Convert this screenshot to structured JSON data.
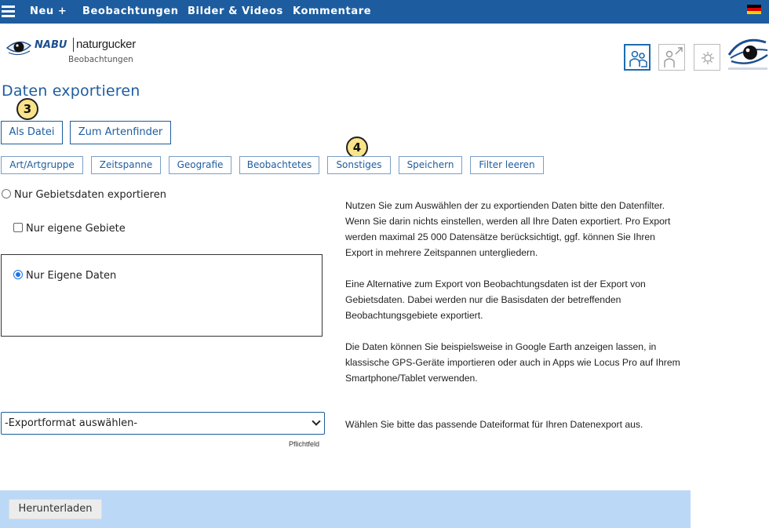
{
  "nav": {
    "items": [
      "Neu +",
      "Beobachtungen",
      "Bilder & Videos",
      "Kommentare"
    ],
    "flag_icon": "german-flag-icon"
  },
  "header": {
    "logo_nabu": "NABU",
    "logo_naturgucker": "naturgucker",
    "logo_subtitle": "Beobachtungen",
    "icons": [
      "community-icon",
      "user-share-icon",
      "settings-icon"
    ]
  },
  "page": {
    "title": "Daten exportieren"
  },
  "markers": [
    "3",
    "4"
  ],
  "mode_buttons": [
    "Als Datei",
    "Zum Artenfinder"
  ],
  "filter_buttons": [
    "Art/Artgruppe",
    "Zeitspanne",
    "Geografie",
    "Beobachtetes",
    "Sonstiges",
    "Speichern",
    "Filter leeren"
  ],
  "options": {
    "area_data_label": "Nur Gebietsdaten exportieren",
    "own_areas_label": "Nur eigene Gebiete",
    "own_data_label": "Nur Eigene Daten"
  },
  "info": {
    "p1": "Nutzen Sie zum Auswählen der zu exportienden Daten bitte den Datenfilter. Wenn Sie darin nichts einstellen, werden all Ihre Daten exportiert. Pro Export werden maximal 25 000 Datensätze berücksichtigt, ggf. können Sie Ihren Export in mehrere Zeitspannen untergliedern.",
    "p2": "Eine Alternative zum Export von Beobachtungsdaten ist der Export von Gebietsdaten. Dabei werden nur die Basisdaten der betreffenden Beobachtungsgebiete exportiert.",
    "p3": "Die Daten können Sie beispielsweise in Google Earth anzeigen lassen, in klassische GPS-Geräte importieren oder auch in Apps wie Locus Pro auf Ihrem Smartphone/Tablet verwenden.",
    "format_hint": "Wählen Sie bitte das passende Dateiformat für Ihren Datenexport aus."
  },
  "export": {
    "format_selected": "-Exportformat auswählen-",
    "required_label": "Pflichtfeld",
    "download_label": "Herunterladen"
  },
  "colors": {
    "nav_bg": "#1d5d9f",
    "accent": "#1d5d9f",
    "marker_fill": "#fbe38a",
    "download_band": "#bcd8f7"
  }
}
